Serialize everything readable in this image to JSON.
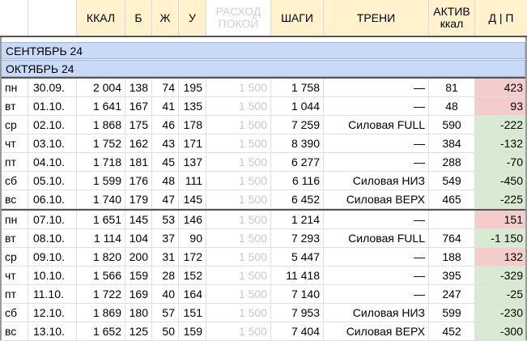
{
  "header": {
    "kcal": "ККАЛ",
    "b": "Б",
    "zh": "Ж",
    "u": "У",
    "rashod": "РАСХОД ПОКОЙ",
    "steps": "ШАГИ",
    "training": "ТРЕНИ",
    "active_line1": "АКТИВ",
    "active_line2": "ккал",
    "dp": "Д | П"
  },
  "months": {
    "september": "СЕНТЯБРЬ 24",
    "october": "ОКТЯБРЬ 24"
  },
  "rows": [
    {
      "day": "пн",
      "date": "30.09.",
      "kcal": "2 004",
      "b": "138",
      "zh": "74",
      "u": "195",
      "rest": "1 500",
      "steps": "1 758",
      "train": "—",
      "active": "81",
      "dp": "423",
      "sign": "pos"
    },
    {
      "day": "вт",
      "date": "01.10.",
      "kcal": "1 641",
      "b": "167",
      "zh": "41",
      "u": "135",
      "rest": "1 500",
      "steps": "1 044",
      "train": "—",
      "active": "48",
      "dp": "93",
      "sign": "pos"
    },
    {
      "day": "ср",
      "date": "02.10.",
      "kcal": "1 868",
      "b": "175",
      "zh": "46",
      "u": "178",
      "rest": "1 500",
      "steps": "7 259",
      "train": "Силовая FULL",
      "active": "590",
      "dp": "-222",
      "sign": "neg"
    },
    {
      "day": "чт",
      "date": "03.10.",
      "kcal": "1 752",
      "b": "162",
      "zh": "43",
      "u": "171",
      "rest": "1 500",
      "steps": "8 390",
      "train": "—",
      "active": "384",
      "dp": "-132",
      "sign": "neg"
    },
    {
      "day": "пт",
      "date": "04.10.",
      "kcal": "1 718",
      "b": "181",
      "zh": "45",
      "u": "137",
      "rest": "1 500",
      "steps": "6 277",
      "train": "—",
      "active": "288",
      "dp": "-70",
      "sign": "neg"
    },
    {
      "day": "сб",
      "date": "05.10.",
      "kcal": "1 599",
      "b": "176",
      "zh": "48",
      "u": "111",
      "rest": "1 500",
      "steps": "6 116",
      "train": "Силовая НИЗ",
      "active": "549",
      "dp": "-450",
      "sign": "neg"
    },
    {
      "day": "вс",
      "date": "06.10.",
      "kcal": "1 740",
      "b": "179",
      "zh": "47",
      "u": "145",
      "rest": "1 500",
      "steps": "6 452",
      "train": "Силовая ВЕРХ",
      "active": "465",
      "dp": "-225",
      "sign": "neg"
    },
    {
      "day": "пн",
      "date": "07.10.",
      "kcal": "1 651",
      "b": "145",
      "zh": "53",
      "u": "146",
      "rest": "1 500",
      "steps": "1 214",
      "train": "—",
      "active": "",
      "dp": "151",
      "sign": "pos"
    },
    {
      "day": "вт",
      "date": "08.10.",
      "kcal": "1 114",
      "b": "104",
      "zh": "37",
      "u": "90",
      "rest": "1 500",
      "steps": "7 293",
      "train": "Силовая FULL",
      "active": "764",
      "dp": "-1 150",
      "sign": "neg"
    },
    {
      "day": "ср",
      "date": "09.10.",
      "kcal": "1 820",
      "b": "200",
      "zh": "31",
      "u": "172",
      "rest": "1 500",
      "steps": "5 447",
      "train": "—",
      "active": "188",
      "dp": "132",
      "sign": "pos"
    },
    {
      "day": "чт",
      "date": "10.10.",
      "kcal": "1 566",
      "b": "159",
      "zh": "28",
      "u": "152",
      "rest": "1 500",
      "steps": "11 418",
      "train": "—",
      "active": "395",
      "dp": "-329",
      "sign": "neg"
    },
    {
      "day": "пт",
      "date": "11.10.",
      "kcal": "1 722",
      "b": "169",
      "zh": "40",
      "u": "164",
      "rest": "1 500",
      "steps": "7 140",
      "train": "—",
      "active": "247",
      "dp": "-25",
      "sign": "neg"
    },
    {
      "day": "сб",
      "date": "12.10.",
      "kcal": "1 869",
      "b": "180",
      "zh": "57",
      "u": "151",
      "rest": "1 500",
      "steps": "7 953",
      "train": "Силовая НИЗ",
      "active": "599",
      "dp": "-230",
      "sign": "neg"
    },
    {
      "day": "вс",
      "date": "13.10.",
      "kcal": "1 652",
      "b": "125",
      "zh": "50",
      "u": "159",
      "rest": "1 500",
      "steps": "7 404",
      "train": "Силовая ВЕРХ",
      "active": "452",
      "dp": "-300",
      "sign": "neg"
    }
  ],
  "colors": {
    "header_yellow": "#fff2cc",
    "month_blue": "#c9daf8",
    "surplus_red": "#f4cccc",
    "deficit_green": "#d9ead3"
  }
}
